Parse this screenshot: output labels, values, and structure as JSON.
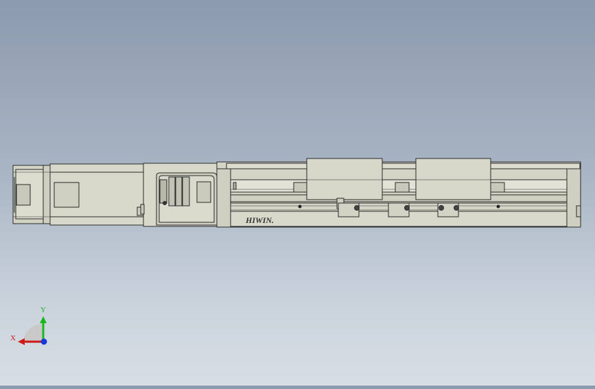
{
  "viewport": {
    "background_top": "#8c9aae",
    "background_bottom": "#d8dee5"
  },
  "model": {
    "brand_text": "HIWIN.",
    "body_color": "#d6d6c9",
    "edge_color": "#2a2a2a"
  },
  "triad": {
    "x_label": "X",
    "y_label": "Y",
    "x_color": "#d01818",
    "y_color": "#18b818",
    "z_color": "#1838d8"
  }
}
